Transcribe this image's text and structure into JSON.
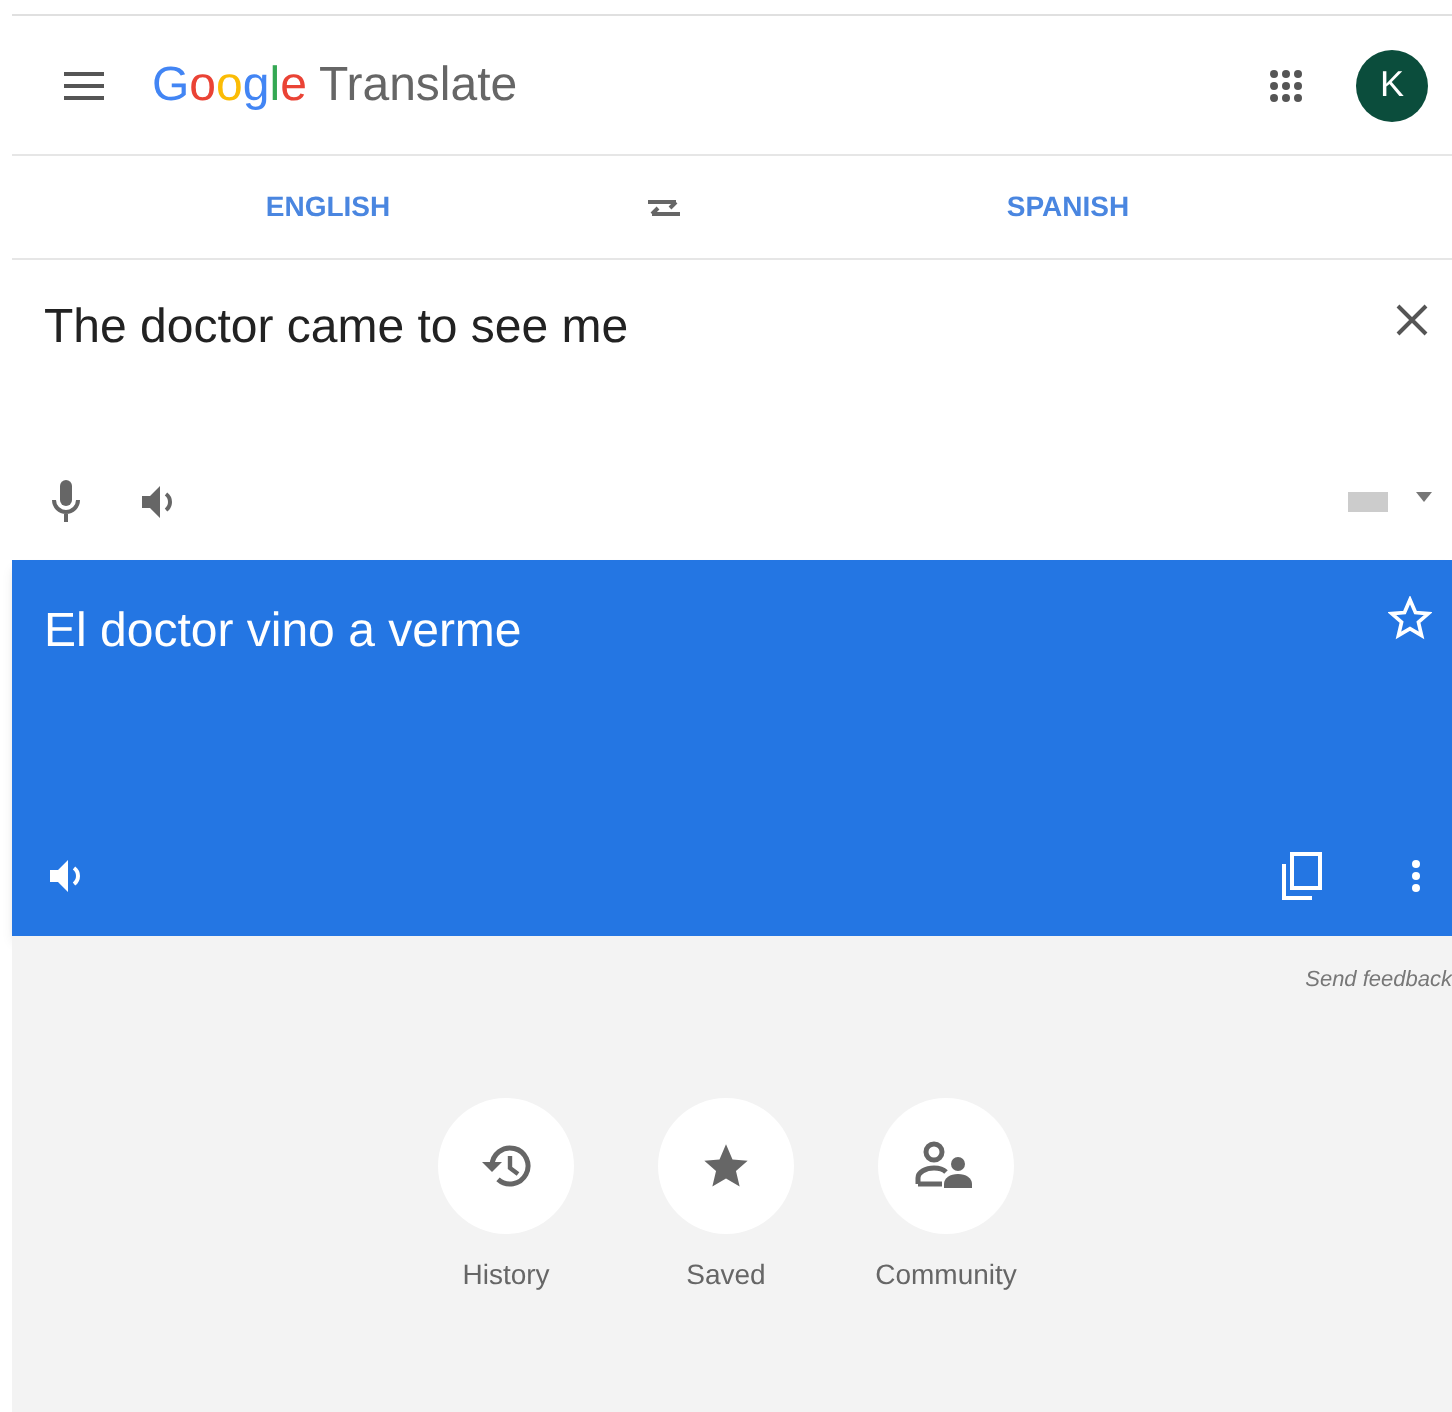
{
  "header": {
    "brand": "Google",
    "product": "Translate",
    "avatar": "K"
  },
  "languages": {
    "source": "ENGLISH",
    "target": "SPANISH"
  },
  "input": {
    "value": "The doctor came to see me"
  },
  "output": {
    "text": "El doctor vino a verme"
  },
  "feedback": "Send feedback",
  "shortcuts": [
    {
      "kind": "history",
      "label": "History"
    },
    {
      "kind": "saved",
      "label": "Saved"
    },
    {
      "kind": "community",
      "label": "Community"
    }
  ]
}
